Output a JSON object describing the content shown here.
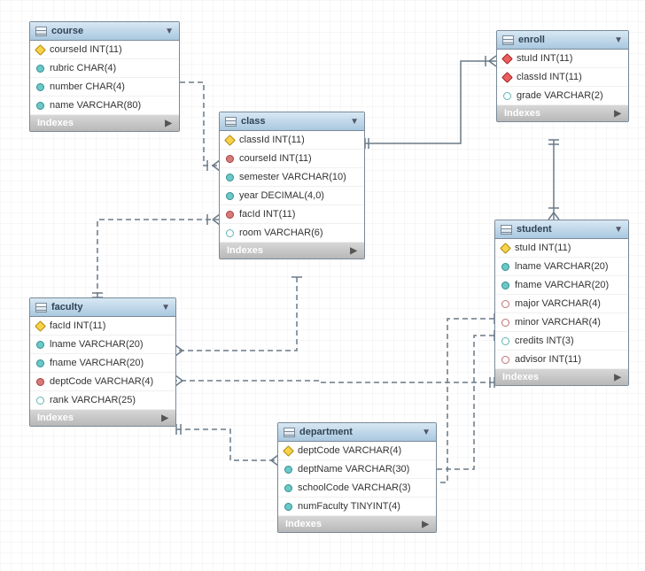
{
  "diagram": {
    "type": "entity-relationship",
    "tool_style": "mysql-workbench"
  },
  "labels": {
    "indexes": "Indexes"
  },
  "tables": {
    "course": {
      "name": "course",
      "columns": {
        "courseId": "courseId INT(11)",
        "rubric": "rubric CHAR(4)",
        "number": "number CHAR(4)",
        "name": "name VARCHAR(80)"
      }
    },
    "class": {
      "name": "class",
      "columns": {
        "classId": "classId INT(11)",
        "courseId": "courseId INT(11)",
        "semester": "semester VARCHAR(10)",
        "year": "year DECIMAL(4,0)",
        "facId": "facId INT(11)",
        "room": "room VARCHAR(6)"
      }
    },
    "enroll": {
      "name": "enroll",
      "columns": {
        "stuId": "stuId INT(11)",
        "classId": "classId INT(11)",
        "grade": "grade VARCHAR(2)"
      }
    },
    "student": {
      "name": "student",
      "columns": {
        "stuId": "stuId INT(11)",
        "lname": "lname VARCHAR(20)",
        "fname": "fname VARCHAR(20)",
        "major": "major VARCHAR(4)",
        "minor": "minor VARCHAR(4)",
        "credits": "credits INT(3)",
        "advisor": "advisor INT(11)"
      }
    },
    "faculty": {
      "name": "faculty",
      "columns": {
        "facId": "facId INT(11)",
        "lname": "lname VARCHAR(20)",
        "fname": "fname VARCHAR(20)",
        "deptCode": "deptCode VARCHAR(4)",
        "rank": "rank VARCHAR(25)"
      }
    },
    "department": {
      "name": "department",
      "columns": {
        "deptCode": "deptCode VARCHAR(4)",
        "deptName": "deptName VARCHAR(30)",
        "schoolCode": "schoolCode VARCHAR(3)",
        "numFaculty": "numFaculty TINYINT(4)"
      }
    }
  }
}
